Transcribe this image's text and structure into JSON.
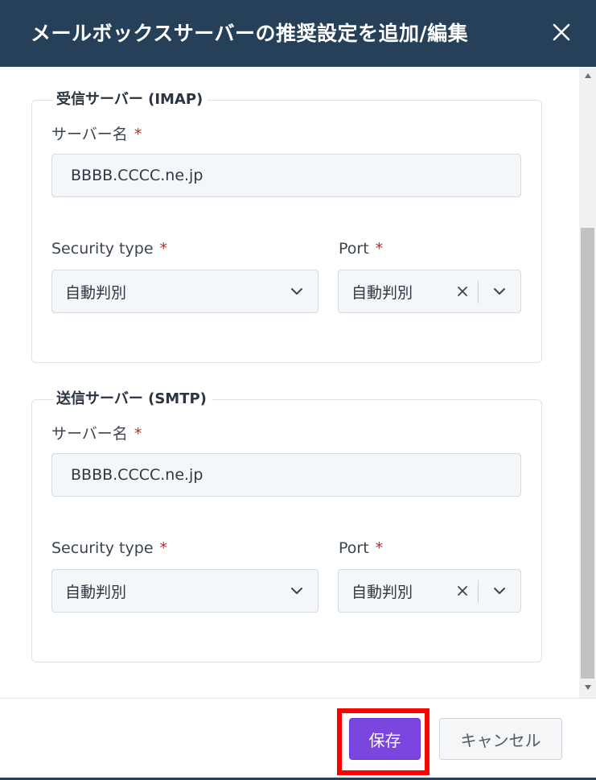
{
  "dialog": {
    "title": "メールボックスサーバーの推奨設定を追加/編集",
    "close_icon": "close-icon"
  },
  "incoming": {
    "legend": "受信サーバー (IMAP)",
    "server_name_label": "サーバー名",
    "server_name_value": "BBBB.CCCC.ne.jp",
    "security_type_label": "Security type",
    "security_type_value": "自動判別",
    "port_label": "Port",
    "port_value": "自動判別"
  },
  "outgoing": {
    "legend": "送信サーバー (SMTP)",
    "server_name_label": "サーバー名",
    "server_name_value": "BBBB.CCCC.ne.jp",
    "security_type_label": "Security type",
    "security_type_value": "自動判別",
    "port_label": "Port",
    "port_value": "自動判別"
  },
  "required_marker": "*",
  "footer": {
    "save_label": "保存",
    "cancel_label": "キャンセル"
  },
  "colors": {
    "header_bg": "#27405a",
    "primary": "#7b45e0",
    "required": "#c0262d",
    "highlight": "#ff0000"
  }
}
